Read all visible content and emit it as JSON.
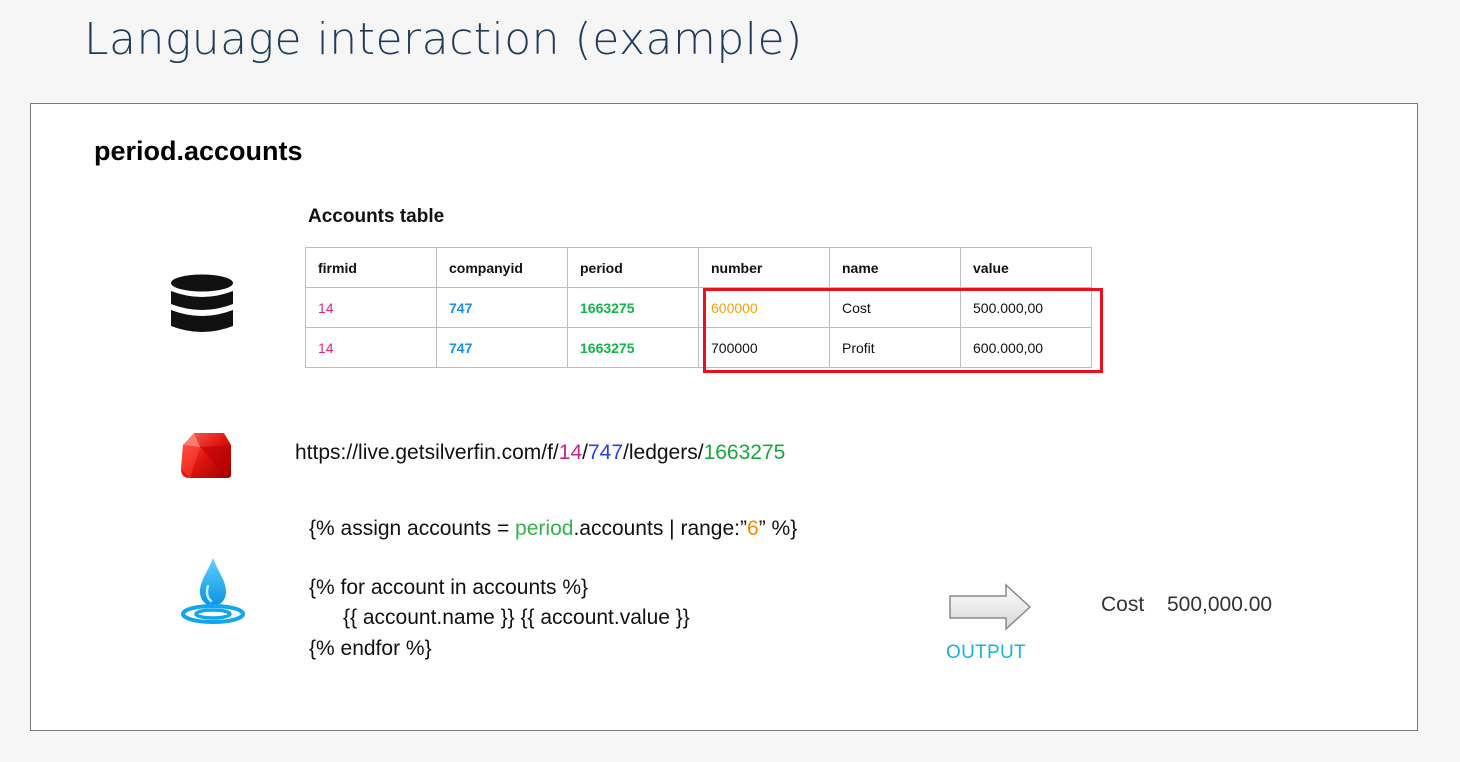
{
  "slide": {
    "title": "Language interaction (example)"
  },
  "object_name": "period.accounts",
  "accounts_table": {
    "title": "Accounts table",
    "columns": [
      "firmid",
      "companyid",
      "period",
      "number",
      "name",
      "value"
    ],
    "rows": [
      [
        "14",
        "747",
        "1663275",
        "600000",
        "Cost",
        "500.000,00"
      ],
      [
        "14",
        "747",
        "1663275",
        "700000",
        "Profit",
        "600.000,00"
      ]
    ]
  },
  "url": {
    "prefix": "https://live.getsilverfin.com/f/",
    "firm_id": "14",
    "sep1": "/",
    "company_id": "747",
    "mid": "/ledgers/",
    "period_id": "1663275"
  },
  "code": {
    "assign_pre": "{% assign accounts = ",
    "assign_period": "period",
    "assign_mid": ".accounts | range:”",
    "assign_range": "6",
    "assign_post": "” %}",
    "for_line": "{% for account in accounts %}",
    "body_line": "{{ account.name }} {{ account.value }}",
    "endfor_line": "{% endfor %}"
  },
  "output": {
    "label": "OUTPUT",
    "name": "Cost",
    "value": "500,000.00"
  },
  "icons": {
    "database": "database-icon",
    "ruby": "ruby-gem-icon",
    "liquid": "water-drop-icon",
    "arrow": "arrow-right-icon"
  },
  "colors": {
    "title": "#1f3b57",
    "firm": "#e0257f",
    "company": "#1a8fe8",
    "period": "#10b54a",
    "number_highlight": "#f2a200",
    "highlight_box": "#e8101a",
    "output_label": "#14b6d6"
  }
}
